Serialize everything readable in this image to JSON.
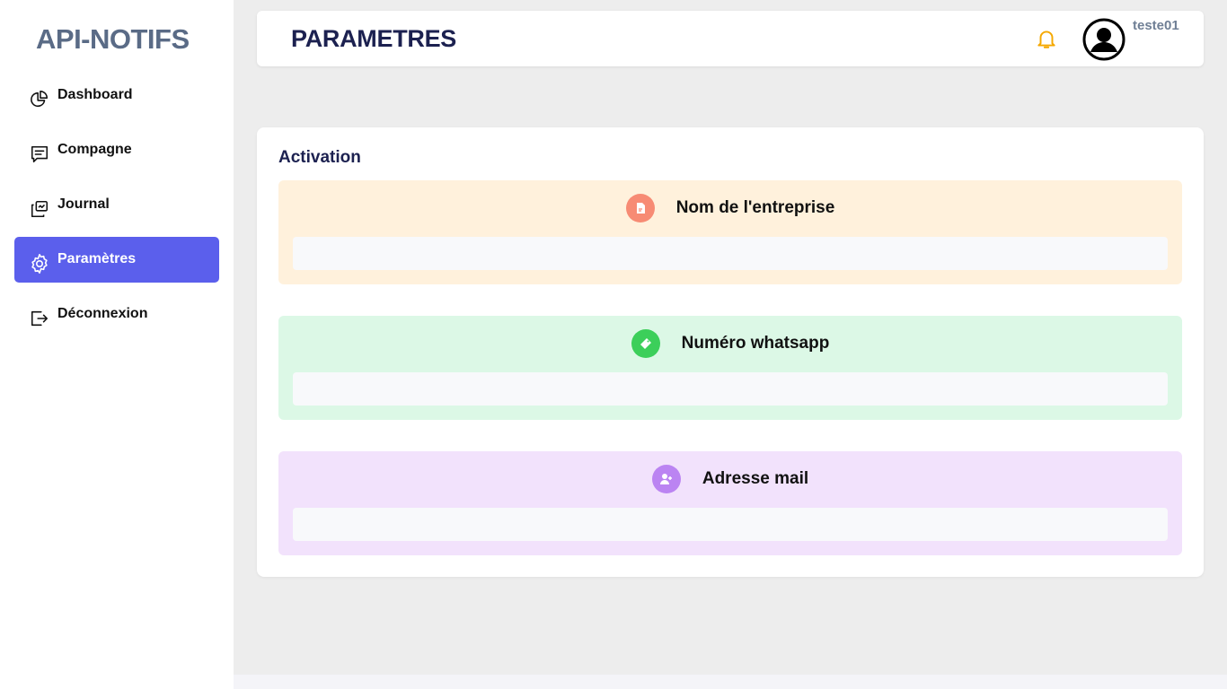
{
  "sidebar": {
    "brand": "API-NOTIFS",
    "items": [
      {
        "label": "Dashboard",
        "icon": "pie-chart-icon"
      },
      {
        "label": "Compagne",
        "icon": "message-icon"
      },
      {
        "label": "Journal",
        "icon": "journal-icon"
      },
      {
        "label": "Paramètres",
        "icon": "gear-icon",
        "active": true
      },
      {
        "label": "Déconnexion",
        "icon": "logout-icon"
      }
    ],
    "accent_color": "#5b5fec"
  },
  "header": {
    "title": "PARAMETRES",
    "username": "teste01",
    "bell_color": "#f5a800"
  },
  "activation": {
    "title": "Activation",
    "fields": [
      {
        "label": "Nom de l'entreprise",
        "icon": "document-icon",
        "value": "",
        "bg": "#fff1dc",
        "icon_bg": "#f78b74"
      },
      {
        "label": "Numéro whatsapp",
        "icon": "tag-icon",
        "value": "",
        "bg": "#dcf8e6",
        "icon_bg": "#3ccf5a"
      },
      {
        "label": "Adresse mail",
        "icon": "add-user-icon",
        "value": "",
        "bg": "#f2e2fc",
        "icon_bg": "#bb84f2"
      }
    ]
  }
}
